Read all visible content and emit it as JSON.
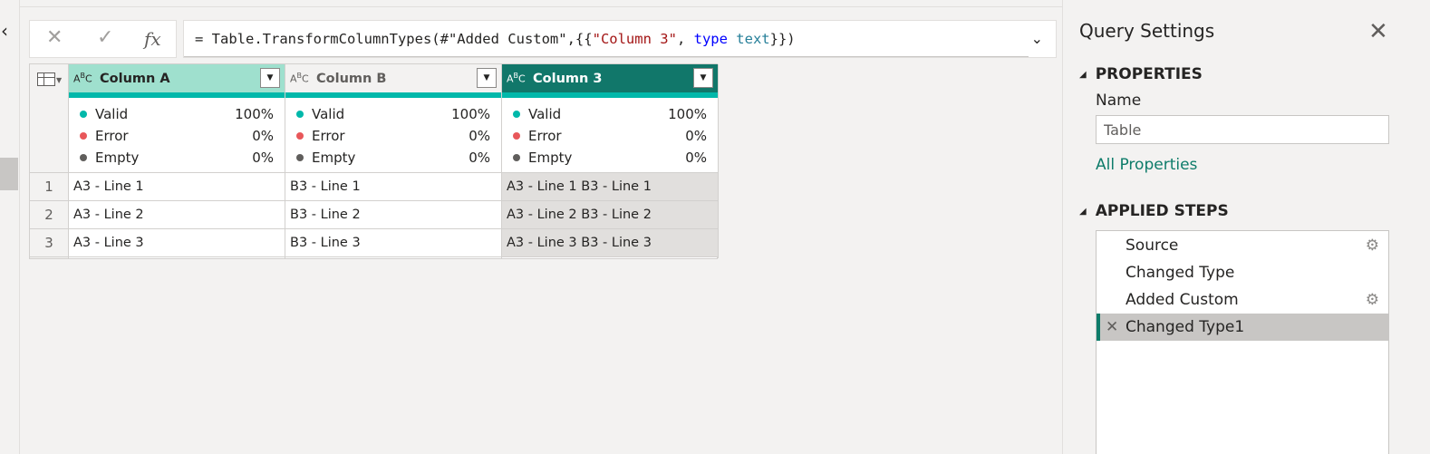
{
  "formula_bar": {
    "cancel_icon": "close-icon",
    "commit_icon": "check-icon",
    "fx_label": "fx",
    "formula_prefix": "= Table.TransformColumnTypes(#\"Added Custom\",{{",
    "formula_string": "\"Column 3\"",
    "formula_sep": ", ",
    "formula_keyword": "type",
    "formula_space": " ",
    "formula_type": "text",
    "formula_suffix": "}})"
  },
  "grid": {
    "columns": [
      {
        "type_icon": "ABC",
        "name": "Column A",
        "header_bg": "#9fe0ce",
        "header_fg": "#252423",
        "quality": {
          "valid_label": "Valid",
          "valid": "100%",
          "error_label": "Error",
          "error": "0%",
          "empty_label": "Empty",
          "empty": "0%"
        },
        "cells": [
          "A3 - Line 1",
          "A3 - Line 2",
          "A3 - Line 3"
        ]
      },
      {
        "type_icon": "ABC",
        "name": "Column B",
        "header_bg": "#f3f2f1",
        "header_fg": "#605e5c",
        "quality": {
          "valid_label": "Valid",
          "valid": "100%",
          "error_label": "Error",
          "error": "0%",
          "empty_label": "Empty",
          "empty": "0%"
        },
        "cells": [
          "B3 - Line 1",
          "B3 - Line 2",
          "B3 - Line 3"
        ]
      },
      {
        "type_icon": "ABC",
        "name": "Column 3",
        "header_bg": "#11776a",
        "header_fg": "#ffffff",
        "quality": {
          "valid_label": "Valid",
          "valid": "100%",
          "error_label": "Error",
          "error": "0%",
          "empty_label": "Empty",
          "empty": "0%"
        },
        "cells": [
          "A3 - Line 1 B3 - Line 1",
          "A3 - Line 2 B3 - Line 2",
          "A3 - Line 3 B3 - Line 3"
        ]
      }
    ],
    "row_numbers": [
      "1",
      "2",
      "3"
    ],
    "colors": {
      "valid": "#01b8aa",
      "error": "#e8575a",
      "empty": "#605e5c",
      "selected_cell_bg": "#e1dfdd"
    }
  },
  "query_settings": {
    "title": "Query Settings",
    "properties_header": "PROPERTIES",
    "name_label": "Name",
    "name_value": "Table",
    "all_properties_link": "All Properties",
    "applied_steps_header": "APPLIED STEPS",
    "steps": [
      {
        "label": "Source",
        "has_gear": true
      },
      {
        "label": "Changed Type",
        "has_gear": false
      },
      {
        "label": "Added Custom",
        "has_gear": true
      },
      {
        "label": "Changed Type1",
        "has_gear": false,
        "selected": true
      }
    ]
  }
}
